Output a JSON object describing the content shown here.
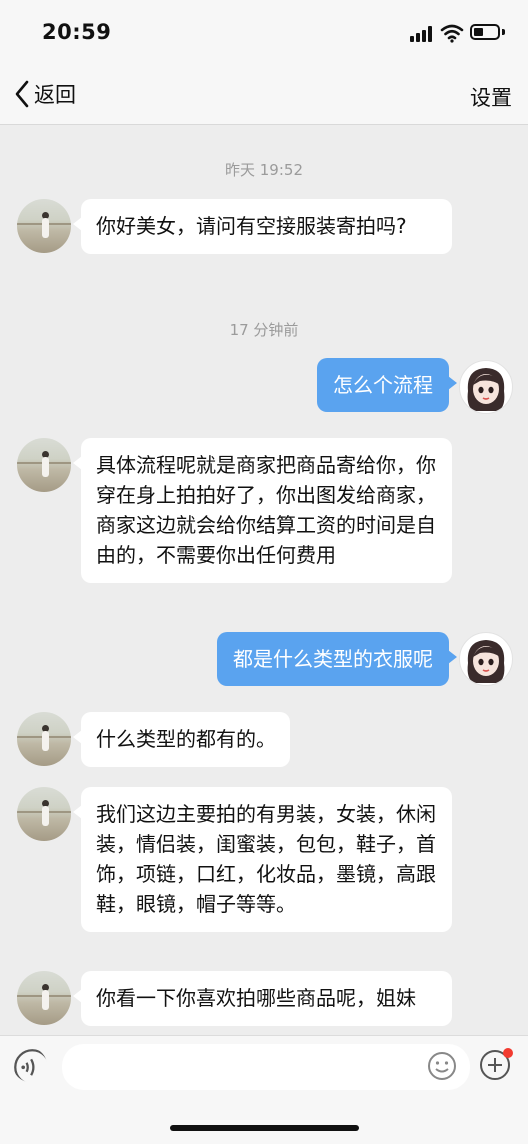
{
  "status_bar": {
    "time": "20:59"
  },
  "nav": {
    "back_label": "返回",
    "settings_label": "设置"
  },
  "messages": [
    {
      "type": "time",
      "text": "昨天 19:52"
    },
    {
      "type": "in",
      "text": "你好美女，请问有空接服装寄拍吗?"
    },
    {
      "type": "time",
      "text": "17 分钟前"
    },
    {
      "type": "out",
      "text": "怎么个流程"
    },
    {
      "type": "in",
      "text": "具体流程呢就是商家把商品寄给你，你穿在身上拍拍好了，你出图发给商家，商家这边就会给你结算工资的时间是自由的，不需要你出任何费用"
    },
    {
      "type": "out",
      "text": "都是什么类型的衣服呢"
    },
    {
      "type": "in",
      "text": "什么类型的都有的。"
    },
    {
      "type": "in",
      "text": "我们这边主要拍的有男装，女装，休闲装，情侣装，闺蜜装，包包，鞋子，首饰，项链，口红，化妆品，墨镜，高跟鞋，眼镜，帽子等等。"
    },
    {
      "type": "in",
      "text": "你看一下你喜欢拍哪些商品呢，姐妹"
    }
  ],
  "input": {
    "placeholder": ""
  },
  "icons": {
    "back": "chevron-left-icon",
    "voice": "voice-icon",
    "emoji": "emoji-icon",
    "plus": "plus-icon"
  },
  "colors": {
    "outgoing_bubble": "#5aa3ef",
    "background": "#ededed",
    "badge": "#f23b30"
  }
}
